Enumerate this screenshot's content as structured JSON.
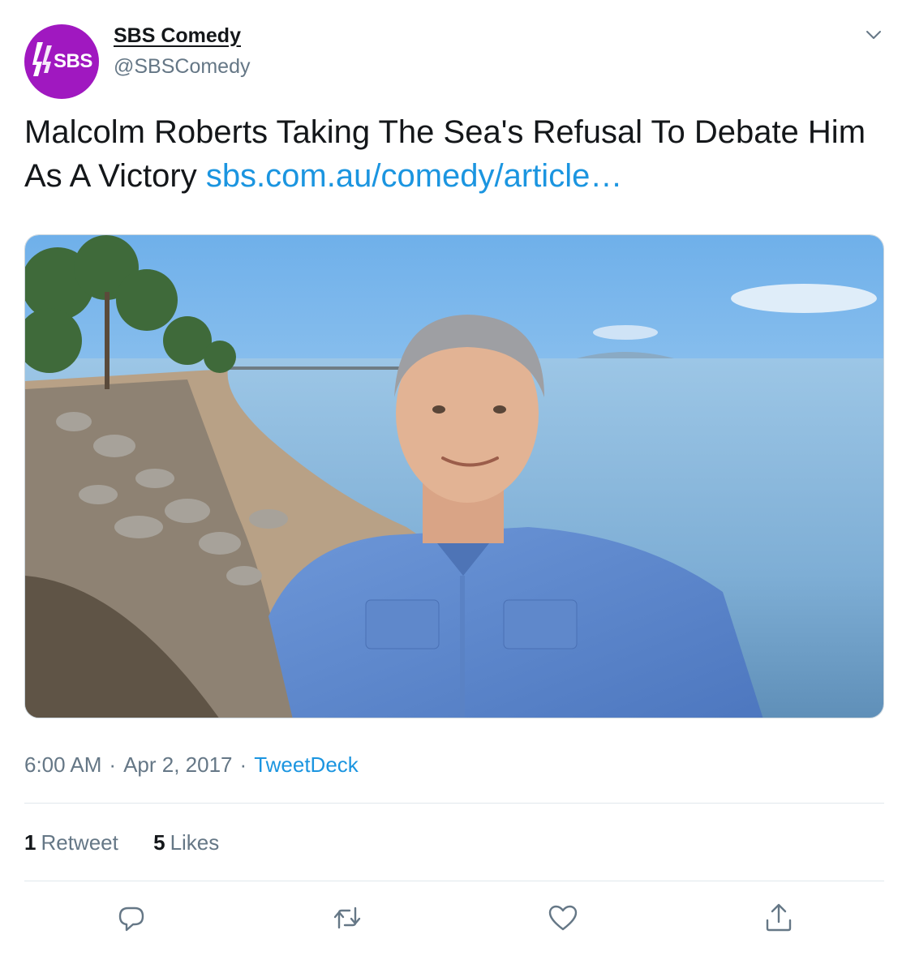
{
  "account": {
    "display_name": "SBS Comedy",
    "handle": "@SBSComedy",
    "avatar_text": "SBS",
    "avatar_color": "#a018c0"
  },
  "tweet": {
    "text": "Malcolm Roberts Taking The Sea's Refusal To Debate Him As A Victory ",
    "link_text": "sbs.com.au/comedy/article…",
    "link_color": "#1b95e0"
  },
  "meta": {
    "time": "6:00 AM",
    "separator": "·",
    "date": "Apr 2, 2017",
    "source": "TweetDeck"
  },
  "stats": {
    "retweets_count": "1",
    "retweets_label": "Retweet",
    "likes_count": "5",
    "likes_label": "Likes"
  },
  "icons": {
    "menu": "chevron-down-icon",
    "reply": "reply-icon",
    "retweet": "retweet-icon",
    "like": "heart-icon",
    "share": "share-icon"
  }
}
